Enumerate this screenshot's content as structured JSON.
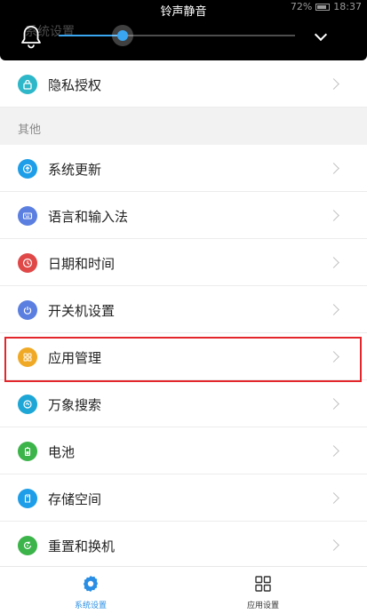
{
  "status_bar": {
    "notification_title": "铃声静音",
    "battery": "72%",
    "time": "18:37"
  },
  "volume_panel": {
    "behind_title": "系统设置",
    "level": 0.27
  },
  "settings": {
    "privacy": {
      "label": "隐私授权",
      "icon": "lock-icon",
      "color": "#2db7c8"
    },
    "other_header": "其他",
    "items": [
      {
        "label": "系统更新",
        "icon": "update-icon",
        "color": "#1e9ee8"
      },
      {
        "label": "语言和输入法",
        "icon": "keyboard-icon",
        "color": "#5b7fe0"
      },
      {
        "label": "日期和时间",
        "icon": "clock-icon",
        "color": "#e04848"
      },
      {
        "label": "开关机设置",
        "icon": "power-icon",
        "color": "#5b7fe0"
      },
      {
        "label": "应用管理",
        "icon": "apps-grid-icon",
        "color": "#f0a925"
      },
      {
        "label": "万象搜索",
        "icon": "search-icon",
        "color": "#1ea7d6"
      },
      {
        "label": "电池",
        "icon": "battery-icon",
        "color": "#3cb44a"
      },
      {
        "label": "存储空间",
        "icon": "sd-card-icon",
        "color": "#1e9ee8"
      },
      {
        "label": "重置和换机",
        "icon": "reset-icon",
        "color": "#3cb44a"
      }
    ]
  },
  "bottom_nav": {
    "system_settings": "系统设置",
    "app_settings": "应用设置",
    "active_color": "#2a8fe4"
  }
}
